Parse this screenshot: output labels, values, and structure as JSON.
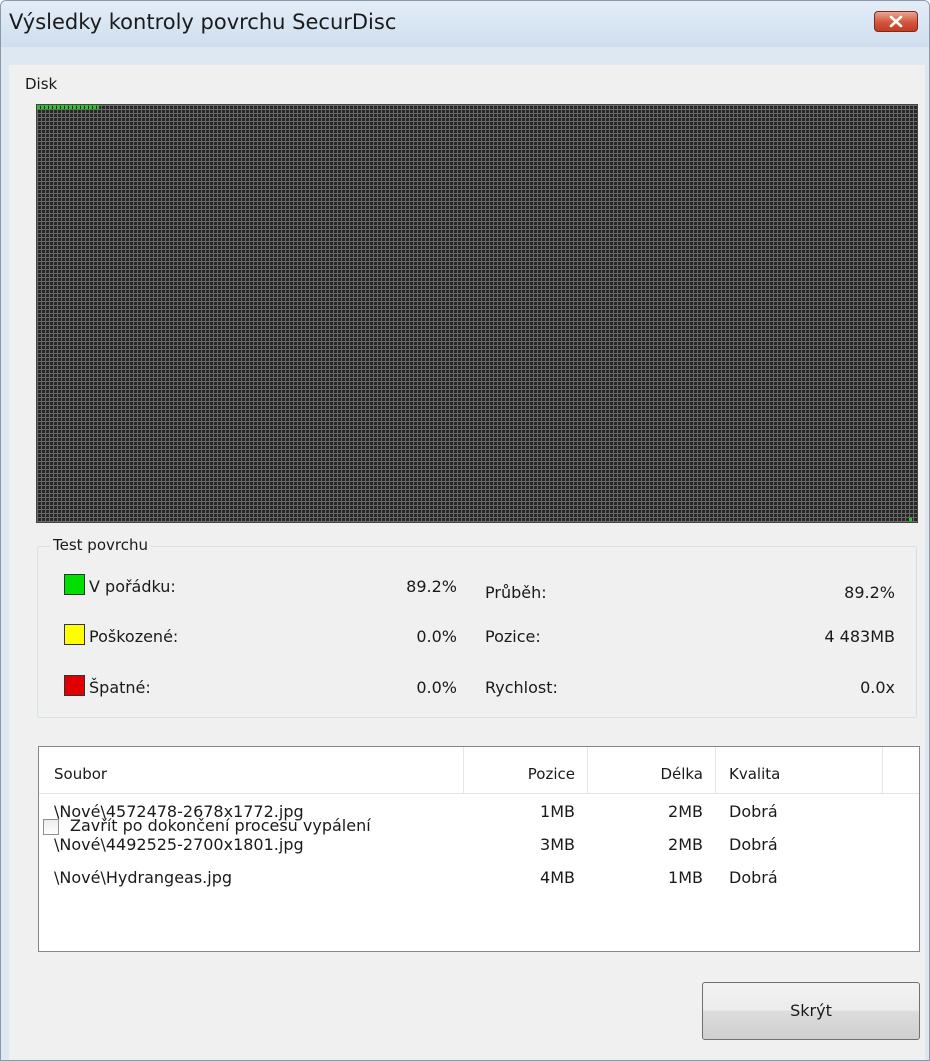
{
  "window": {
    "title": "Výsledky kontroly povrchu SecurDisc"
  },
  "disk": {
    "label": "Disk",
    "colors": {
      "background": "#272727",
      "grid": "#6a6a6a",
      "ok": "#27c427"
    }
  },
  "surface_test": {
    "title": "Test povrchu",
    "legend": [
      {
        "label": "V pořádku:",
        "value": "89.2%",
        "color": "#00e000"
      },
      {
        "label": "Poškozené:",
        "value": "0.0%",
        "color": "#ffff00"
      },
      {
        "label": "Špatné:",
        "value": "0.0%",
        "color": "#e00000"
      }
    ],
    "stats": [
      {
        "label": "Průběh:",
        "value": "89.2%"
      },
      {
        "label": "Pozice:",
        "value": "4 483MB"
      },
      {
        "label": "Rychlost:",
        "value": "0.0x"
      }
    ]
  },
  "file_list": {
    "columns": [
      "Soubor",
      "Pozice",
      "Délka",
      "Kvalita"
    ],
    "rows": [
      [
        "\\Nové\\4572478-2678x1772.jpg",
        "1MB",
        "2MB",
        "Dobrá"
      ],
      [
        "\\Nové\\4492525-2700x1801.jpg",
        "3MB",
        "2MB",
        "Dobrá"
      ],
      [
        "\\Nové\\Hydrangeas.jpg",
        "4MB",
        "1MB",
        "Dobrá"
      ]
    ]
  },
  "footer": {
    "close_after_burn_label": "Zavřít po dokončení procesu vypálení",
    "close_after_burn_checked": false,
    "hide_button_label": "Skrýt"
  }
}
